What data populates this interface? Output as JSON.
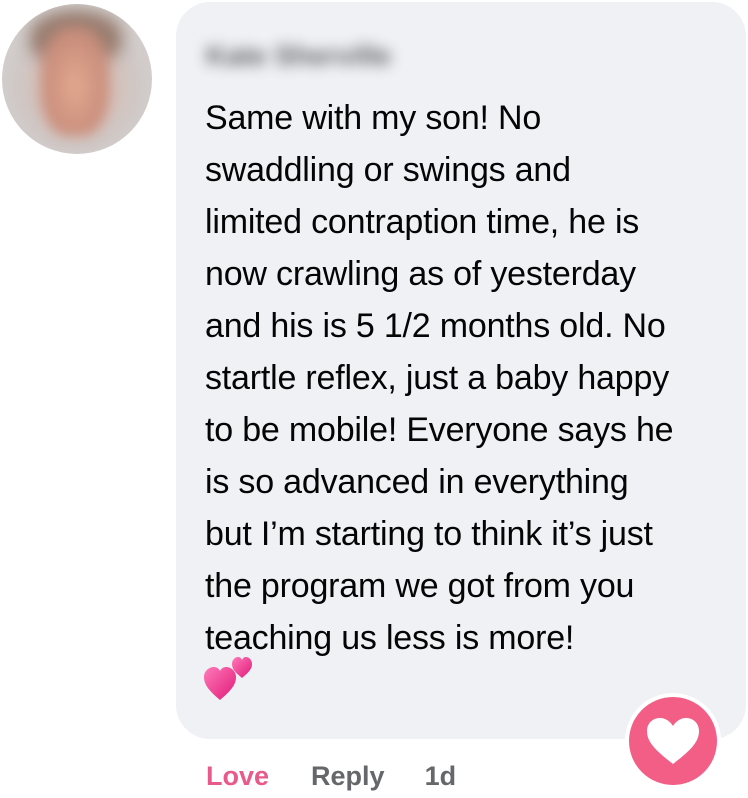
{
  "comment": {
    "author": "Kate Sherville",
    "lines": [
      "Same with my son! No",
      "swaddling or swings and",
      "limited contraption time, he is",
      "now crawling as of yesterday",
      "and his is 5 1/2 months old. No",
      "startle reflex, just a baby happy",
      "to be mobile! Everyone says he",
      "is so advanced in everything",
      "but I’m starting to think it’s just",
      "the program we got from you",
      "teaching us less is more!"
    ],
    "emoji": "💕",
    "emoji_icon": "two-hearts-icon"
  },
  "actions": {
    "love_label": "Love",
    "reply_label": "Reply",
    "timestamp": "1d"
  },
  "reaction": {
    "icon": "heart-icon",
    "color": "#f25e86"
  },
  "colors": {
    "bubble_background": "#eff1f5",
    "love_active": "#e85a8a",
    "secondary_text": "#65676b"
  }
}
